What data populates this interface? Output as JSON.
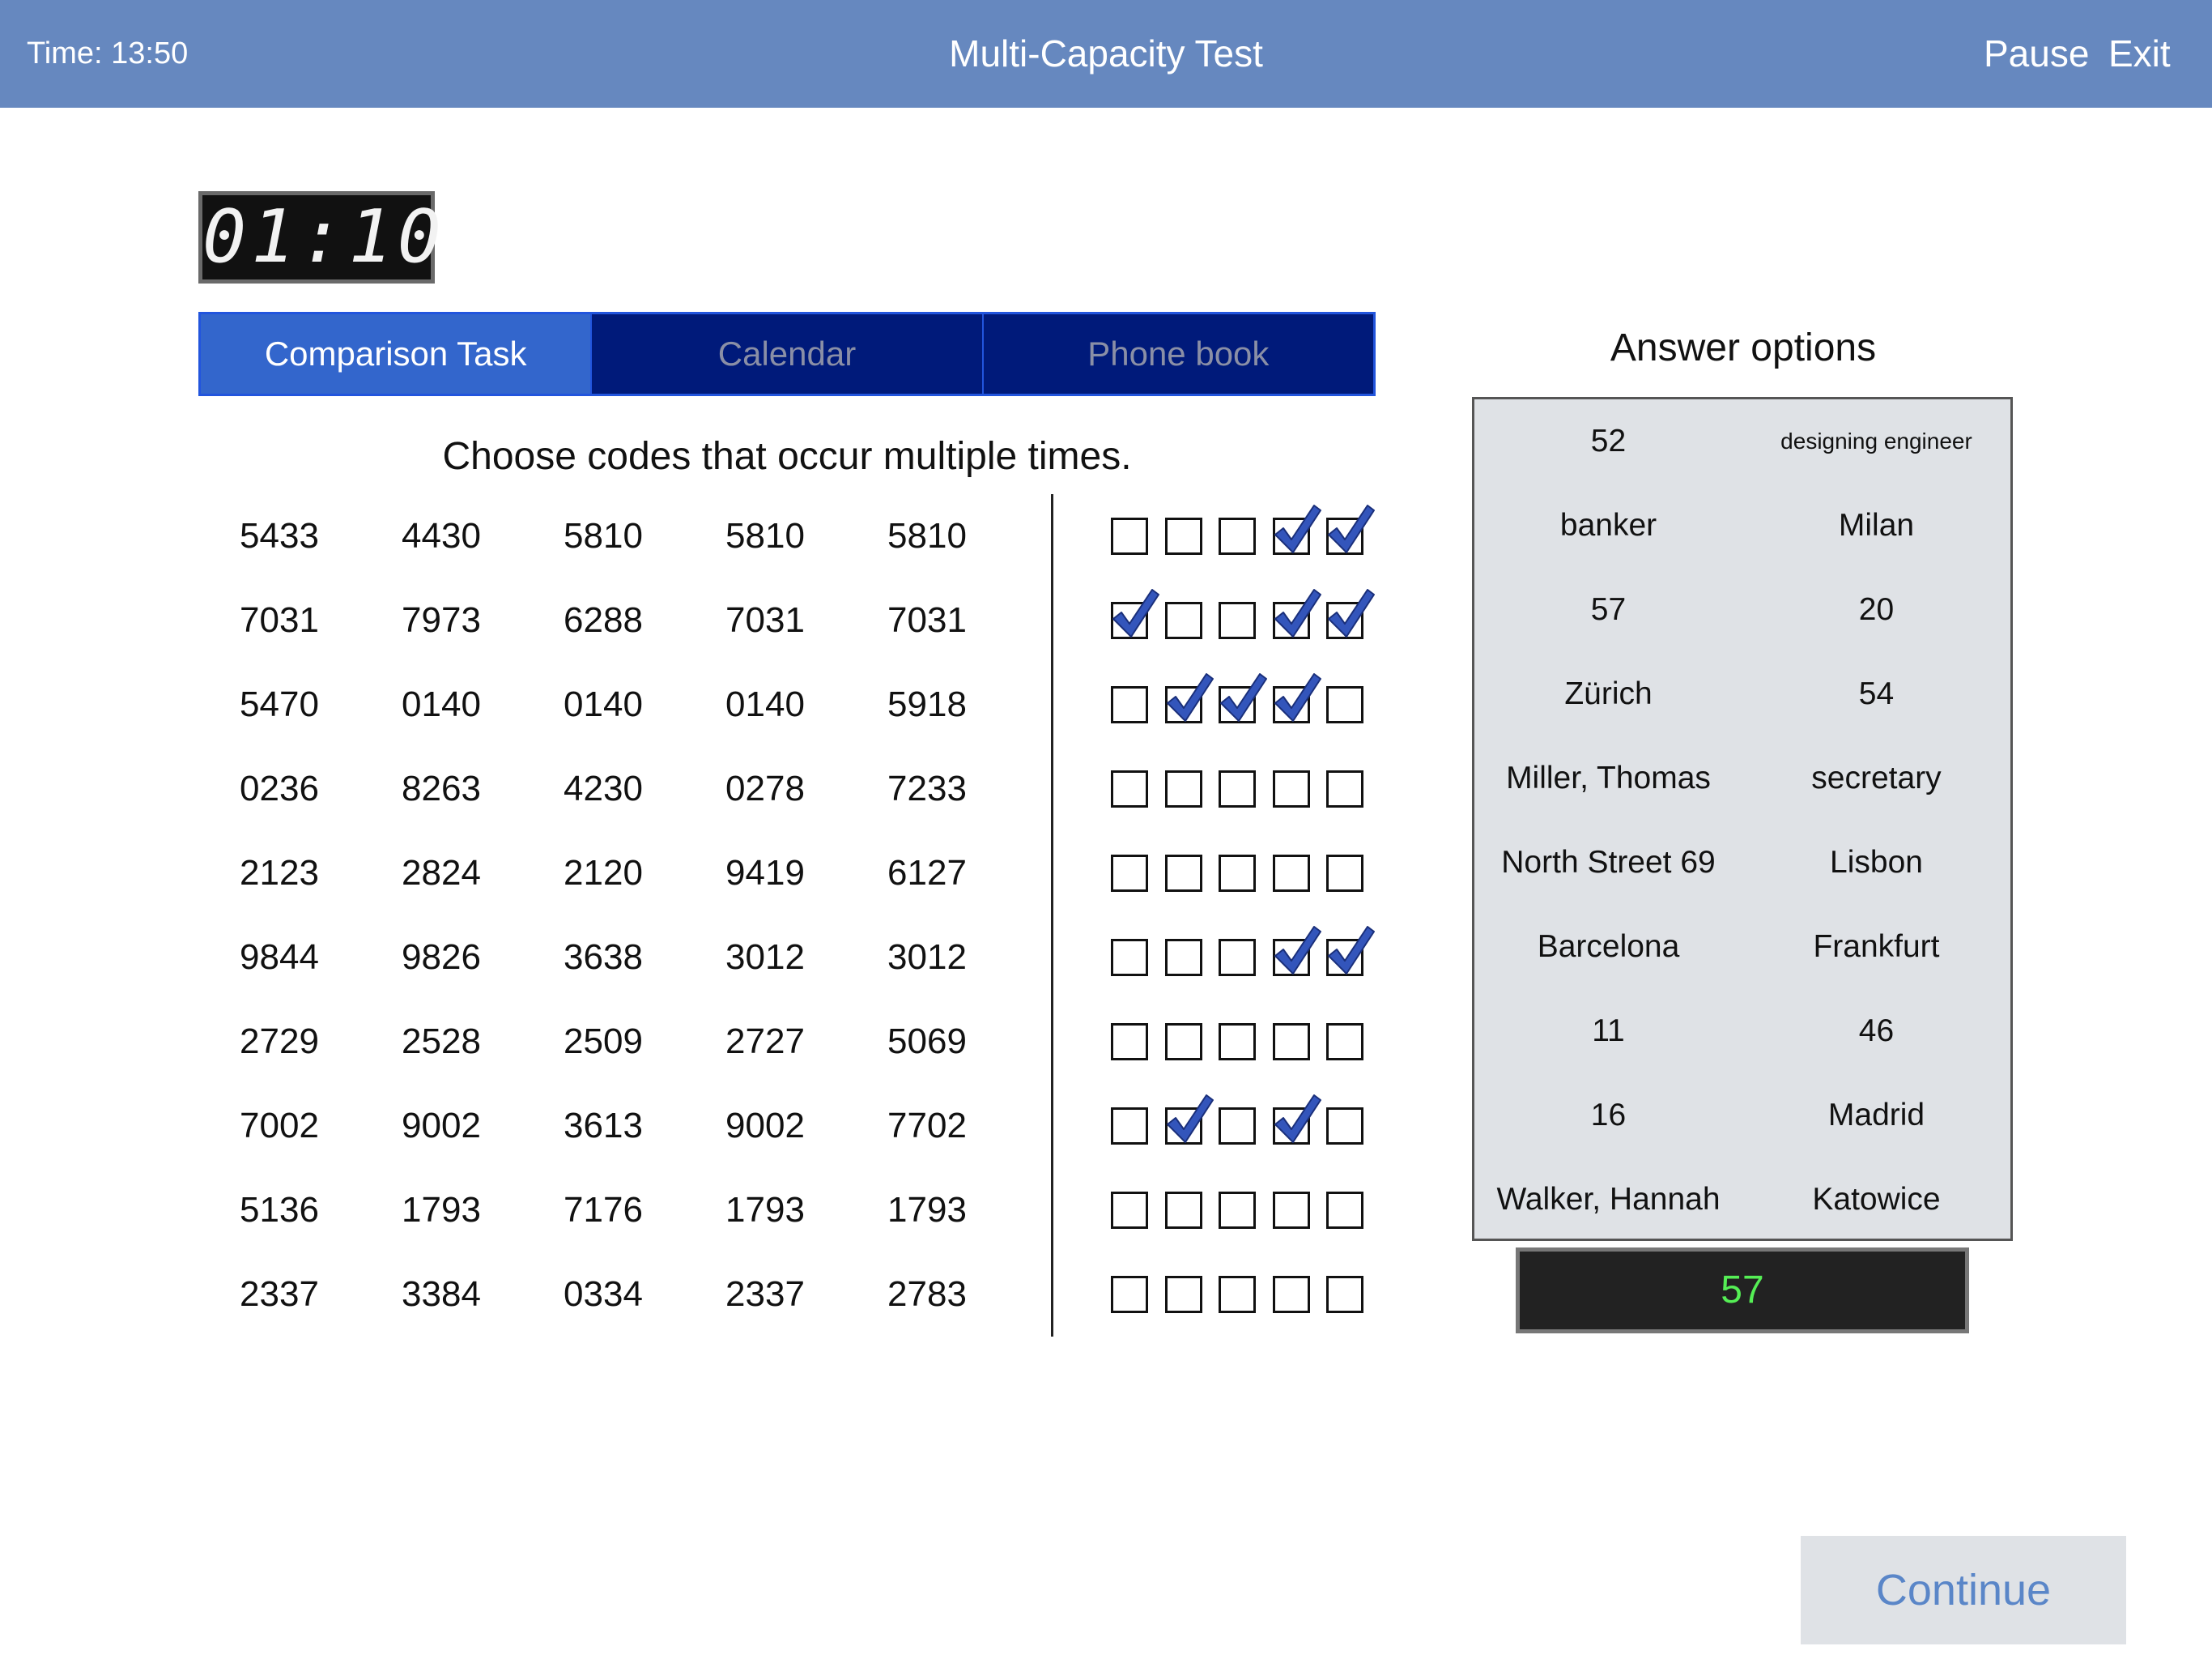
{
  "header": {
    "time_label": "Time: 13:50",
    "title": "Multi-Capacity Test",
    "pause_label": "Pause",
    "exit_label": "Exit"
  },
  "timer": {
    "display": "01:10"
  },
  "tabs": [
    {
      "label": "Comparison Task",
      "active": true
    },
    {
      "label": "Calendar",
      "active": false
    },
    {
      "label": "Phone book",
      "active": false
    }
  ],
  "instruction": "Choose codes that occur multiple times.",
  "code_rows": [
    {
      "codes": [
        "5433",
        "4430",
        "5810",
        "5810",
        "5810"
      ],
      "checked": [
        false,
        false,
        false,
        true,
        true
      ]
    },
    {
      "codes": [
        "7031",
        "7973",
        "6288",
        "7031",
        "7031"
      ],
      "checked": [
        true,
        false,
        false,
        true,
        true
      ]
    },
    {
      "codes": [
        "5470",
        "0140",
        "0140",
        "0140",
        "5918"
      ],
      "checked": [
        false,
        true,
        true,
        true,
        false
      ]
    },
    {
      "codes": [
        "0236",
        "8263",
        "4230",
        "0278",
        "7233"
      ],
      "checked": [
        false,
        false,
        false,
        false,
        false
      ]
    },
    {
      "codes": [
        "2123",
        "2824",
        "2120",
        "9419",
        "6127"
      ],
      "checked": [
        false,
        false,
        false,
        false,
        false
      ]
    },
    {
      "codes": [
        "9844",
        "9826",
        "3638",
        "3012",
        "3012"
      ],
      "checked": [
        false,
        false,
        false,
        true,
        true
      ]
    },
    {
      "codes": [
        "2729",
        "2528",
        "2509",
        "2727",
        "5069"
      ],
      "checked": [
        false,
        false,
        false,
        false,
        false
      ]
    },
    {
      "codes": [
        "7002",
        "9002",
        "3613",
        "9002",
        "7702"
      ],
      "checked": [
        false,
        true,
        false,
        true,
        false
      ]
    },
    {
      "codes": [
        "5136",
        "1793",
        "7176",
        "1793",
        "1793"
      ],
      "checked": [
        false,
        false,
        false,
        false,
        false
      ]
    },
    {
      "codes": [
        "2337",
        "3384",
        "0334",
        "2337",
        "2783"
      ],
      "checked": [
        false,
        false,
        false,
        false,
        false
      ]
    }
  ],
  "answer_options": {
    "title": "Answer options",
    "rows": [
      [
        "52",
        "designing engineer"
      ],
      [
        "banker",
        "Milan"
      ],
      [
        "57",
        "20"
      ],
      [
        "Zürich",
        "54"
      ],
      [
        "Miller, Thomas",
        "secretary"
      ],
      [
        "North Street 69",
        "Lisbon"
      ],
      [
        "Barcelona",
        "Frankfurt"
      ],
      [
        "11",
        "46"
      ],
      [
        "16",
        "Madrid"
      ],
      [
        "Walker, Hannah",
        "Katowice"
      ]
    ]
  },
  "answer_display": "57",
  "continue_label": "Continue",
  "colors": {
    "header_bg": "#6688bf",
    "tab_active": "#3366cc",
    "tab_inactive": "#001a7a",
    "checkmark": "#3355bb",
    "answer_text": "#55ee55",
    "continue_text": "#5a86c8"
  }
}
